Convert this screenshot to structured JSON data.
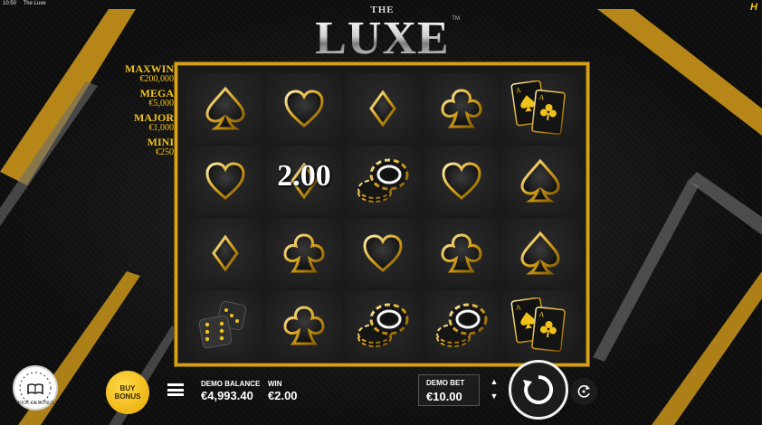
{
  "status_bar": {
    "time": "10:50",
    "app_name": "The Luxe"
  },
  "title": {
    "the": "THE",
    "main": "LUXE",
    "trademark": "TM"
  },
  "jackpots": [
    {
      "name": "MAXWIN",
      "value": "€200,000"
    },
    {
      "name": "MEGA",
      "value": "€5,000"
    },
    {
      "name": "MAJOR",
      "value": "€1,000"
    },
    {
      "name": "MINI",
      "value": "€250"
    }
  ],
  "grid": {
    "rows": [
      [
        "spade-icon",
        "heart-icon",
        "diamond-icon",
        "club-icon",
        "aces-cards-icon"
      ],
      [
        "heart-icon",
        "diamond-icon",
        "chips-icon",
        "heart-icon",
        "spade-icon"
      ],
      [
        "diamond-icon",
        "club-icon",
        "heart-icon",
        "club-icon",
        "spade-icon"
      ],
      [
        "dice-icon",
        "club-icon",
        "chips-icon",
        "chips-icon",
        "aces-cards-icon"
      ]
    ],
    "win_overlay": "2.00"
  },
  "bottom_bar": {
    "book_bonus_label": "BOOK OF BONUS",
    "buy_bonus_label_1": "BUY",
    "buy_bonus_label_2": "BONUS",
    "balance_label": "DEMO BALANCE",
    "balance_value": "€4,993.40",
    "win_label": "WIN",
    "win_value": "€2.00",
    "bet_label": "DEMO BET",
    "bet_value": "€10.00"
  },
  "colors": {
    "gold": "#d6a21a",
    "jackpot_text": "#f0c21a",
    "background": "#0c0c0d"
  }
}
